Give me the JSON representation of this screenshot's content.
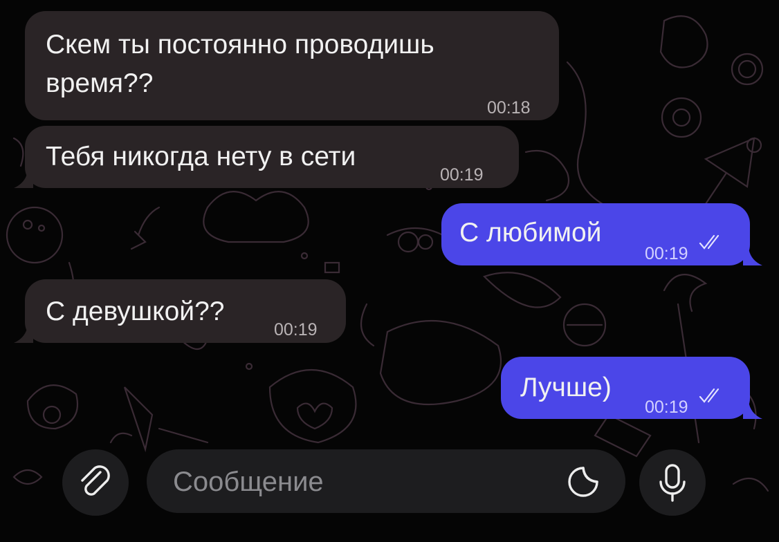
{
  "messages": [
    {
      "direction": "incoming",
      "text_line1": "Скем ты постоянно проводишь",
      "text_line2": "время??",
      "time": "00:18"
    },
    {
      "direction": "incoming",
      "text": "Тебя никогда нету в сети",
      "time": "00:19"
    },
    {
      "direction": "outgoing",
      "text": "С любимой",
      "time": "00:19",
      "status": "read"
    },
    {
      "direction": "incoming",
      "text": "С девушкой??",
      "time": "00:19"
    },
    {
      "direction": "outgoing",
      "text": "Лучше)",
      "time": "00:19",
      "status": "read"
    }
  ],
  "composer": {
    "placeholder": "Сообщение",
    "attach_icon": "paperclip-icon",
    "sticker_icon": "sticker-icon",
    "mic_icon": "microphone-icon"
  },
  "colors": {
    "background": "#050505",
    "incoming_bubble": "#2a2426",
    "outgoing_bubble": "#4b46e8",
    "composer": "#1d1d1f"
  }
}
